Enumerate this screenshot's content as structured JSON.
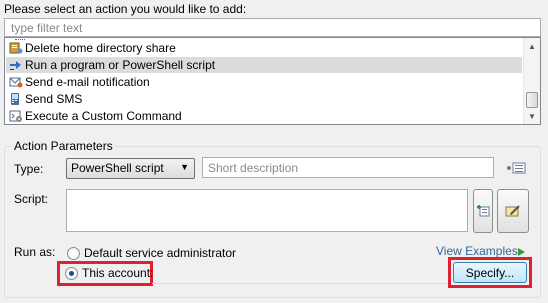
{
  "prompt": "Please select an action you would like to add:",
  "filter": {
    "placeholder": "type filter text",
    "value": ""
  },
  "actions": [
    {
      "label": "Delete home directory share",
      "icon": "share-icon"
    },
    {
      "label": "Run a program or PowerShell script",
      "icon": "run-script-icon"
    },
    {
      "label": "Send e-mail notification",
      "icon": "email-icon"
    },
    {
      "label": "Send SMS",
      "icon": "sms-icon"
    },
    {
      "label": "Execute a Custom Command",
      "icon": "command-icon"
    }
  ],
  "action_parameters": {
    "title": "Action Parameters",
    "type_label": "Type:",
    "type_value": "PowerShell script",
    "description_placeholder": "Short description",
    "script_label": "Script:",
    "run_as_label": "Run as:",
    "option_default": "Default service administrator",
    "option_account": "This account:",
    "view_examples": "View Examples",
    "specify_button": "Specify..."
  },
  "colors": {
    "highlight": "#e0202c",
    "link": "#336699",
    "selected_row": "#dcdcdc"
  }
}
